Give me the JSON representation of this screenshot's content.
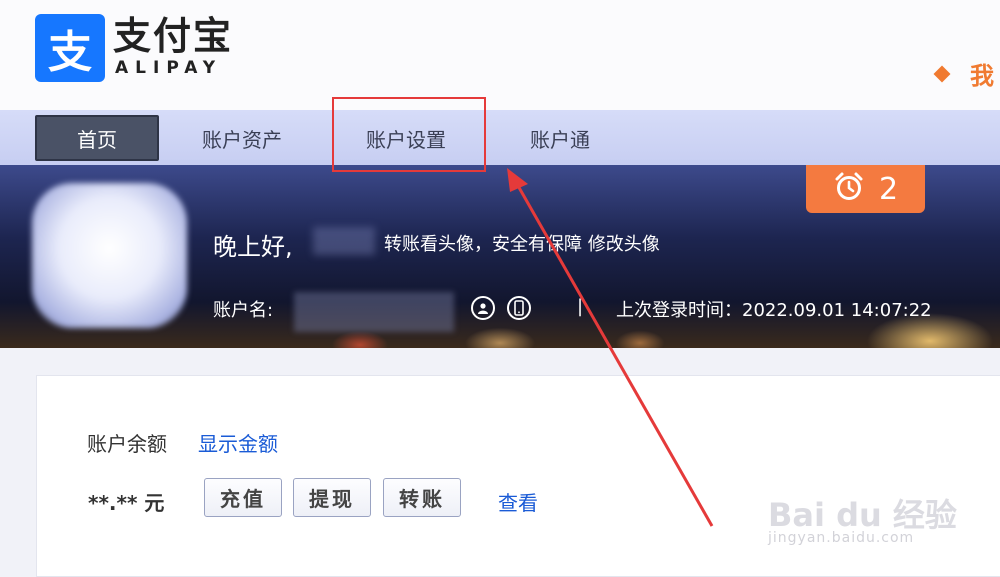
{
  "brand": {
    "logo_glyph": "支",
    "name_cn": "支付宝",
    "name_en": "ALIPAY",
    "top_right_text": "我"
  },
  "nav": {
    "items": [
      {
        "label": "首页",
        "active": true
      },
      {
        "label": "账户资产",
        "active": false
      },
      {
        "label": "账户设置",
        "active": false
      },
      {
        "label": "账户通",
        "active": false
      }
    ]
  },
  "banner": {
    "greeting": "晚上好,",
    "avatar_tip": "转账看头像，安全有保障 修改头像",
    "account_label": "账户名:",
    "divider": "|",
    "last_login": "上次登录时间：2022.09.01 14:07:22",
    "notification_count": "2"
  },
  "balance": {
    "label": "账户余额",
    "show_link": "显示金额",
    "amount": "**.** 元",
    "actions": [
      "充值",
      "提现",
      "转账"
    ],
    "view_link": "查看"
  },
  "watermark": {
    "main": "Bai du 经验",
    "sub": "jingyan.baidu.com"
  },
  "colors": {
    "brand_blue": "#1677ff",
    "link_blue": "#1a5bd6",
    "notify_orange": "#f47a40",
    "annotation_red": "#e53a3a"
  }
}
